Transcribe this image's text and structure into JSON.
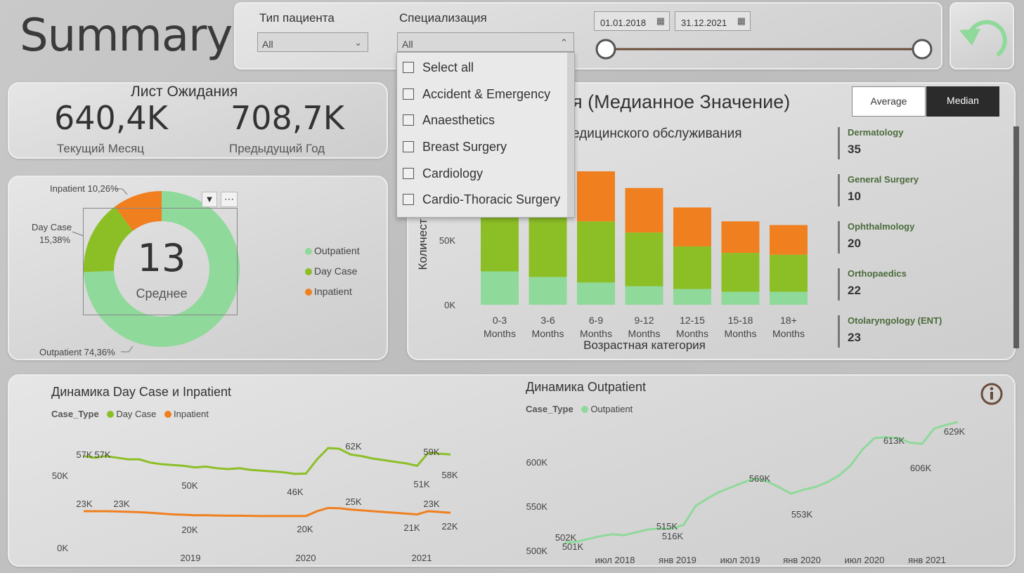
{
  "title": "Summary",
  "filters": {
    "patient_type": {
      "label": "Тип пациента",
      "value": "All"
    },
    "specialization": {
      "label": "Специализация",
      "value": "All"
    },
    "date_from": "01.01.2018",
    "date_to": "31.12.2021"
  },
  "dropdown": {
    "items": [
      "Select all",
      "Accident & Emergency",
      "Anaesthetics",
      "Breast Surgery",
      "Cardiology",
      "Cardio-Thoracic Surgery"
    ]
  },
  "waiting_list": {
    "title": "Лист Ожидания",
    "current_value": "640,4K",
    "current_label": "Текущий Месяц",
    "previous_value": "708,7K",
    "previous_label": "Предыдущий Год"
  },
  "donut": {
    "center_value": "13",
    "center_label": "Среднее",
    "labels": {
      "inpatient": "Inpatient 10,26%",
      "daycase_name": "Day Case",
      "daycase_pct": "15,38%",
      "outpatient": "Outpatient 74,36%"
    },
    "legend": [
      "Outpatient",
      "Day Case",
      "Inpatient"
    ],
    "chart_data": {
      "type": "pie",
      "categories": [
        "Outpatient",
        "Day Case",
        "Inpatient"
      ],
      "values": [
        74.36,
        15.38,
        10.26
      ],
      "colors": [
        "#8fd99a",
        "#8cbf26",
        "#f07f1f"
      ]
    }
  },
  "bar_panel": {
    "title": "я (Медианное Значение)",
    "subtitle": "едицинского обслуживания",
    "ylabel": "Количест",
    "xlabel": "Возрастная категория",
    "toggle": {
      "average": "Average",
      "median": "Median"
    },
    "ticks": [
      "50K",
      "0K"
    ],
    "chart_data": {
      "type": "bar",
      "stacked": true,
      "categories": [
        "0-3 Months",
        "3-6 Months",
        "6-9 Months",
        "9-12 Months",
        "12-15 Months",
        "15-18 Months",
        "18+ Months"
      ],
      "category_lines": [
        [
          "0-3",
          "Months"
        ],
        [
          "3-6",
          "Months"
        ],
        [
          "6-9",
          "Months"
        ],
        [
          "9-12",
          "Months"
        ],
        [
          "12-15",
          "Months"
        ],
        [
          "15-18",
          "Months"
        ],
        [
          "18+",
          "Months"
        ]
      ],
      "series": [
        {
          "values": [
            18000,
            15000,
            12000,
            10000,
            8500,
            7000,
            7000
          ],
          "color": "#8fd99a"
        },
        {
          "values": [
            40000,
            36000,
            33000,
            29000,
            23000,
            21000,
            20000
          ],
          "color": "#8cbf26"
        },
        {
          "values": [
            8000,
            16000,
            27000,
            24000,
            21000,
            17000,
            16000
          ],
          "color": "#f07f1f"
        }
      ],
      "ylim": [
        0,
        72000
      ],
      "xlabel": "Возрастная категория"
    },
    "specialties": [
      {
        "name": "Dermatology",
        "value": "35"
      },
      {
        "name": "General Surgery",
        "value": "10"
      },
      {
        "name": "Ophthalmology",
        "value": "20"
      },
      {
        "name": "Orthopaedics",
        "value": "22"
      },
      {
        "name": "Otolaryngology (ENT)",
        "value": "23"
      }
    ]
  },
  "daycase_chart": {
    "title": "Динамика Day Case и Inpatient",
    "legend_title": "Case_Type",
    "legend": [
      "Day Case",
      "Inpatient"
    ],
    "yticks": [
      "50K",
      "0K"
    ],
    "xticks": [
      "2019",
      "2020",
      "2021"
    ],
    "chart_data": {
      "type": "line",
      "ylim": [
        0,
        75000
      ],
      "series": [
        {
          "name": "Day Case",
          "color": "#8cbf26",
          "values": [
            57000,
            56000,
            57000,
            56000,
            55000,
            55000,
            53000,
            52000,
            51500,
            51000,
            50000,
            50500,
            49500,
            49000,
            49500,
            48500,
            48000,
            47500,
            47000,
            46000,
            46200,
            55000,
            62000,
            61500,
            58000,
            57000,
            55500,
            54500,
            53500,
            52500,
            51000,
            59000,
            58500,
            58000
          ]
        },
        {
          "name": "Inpatient",
          "color": "#f07f1f",
          "values": [
            23000,
            23000,
            23000,
            22800,
            22600,
            22400,
            22000,
            21500,
            21000,
            20800,
            20500,
            20500,
            20300,
            20200,
            20200,
            20100,
            20000,
            20000,
            20000,
            20000,
            20000,
            23000,
            25000,
            24800,
            24000,
            23500,
            23000,
            22500,
            22000,
            21500,
            21000,
            23000,
            22500,
            22000
          ]
        }
      ],
      "labels": {
        "daycase": [
          "57K",
          "57K",
          "50K",
          "46K",
          "62K",
          "51K",
          "59K",
          "58K"
        ],
        "inpatient": [
          "23K",
          "23K",
          "20K",
          "20K",
          "25K",
          "21K",
          "23K",
          "22K"
        ]
      }
    }
  },
  "outpatient_chart": {
    "title": "Динамика Outpatient",
    "legend_title": "Case_Type",
    "legend": [
      "Outpatient"
    ],
    "yticks": [
      "600K",
      "550K",
      "500K"
    ],
    "xticks": [
      "июл 2018",
      "янв 2019",
      "июл 2019",
      "янв 2020",
      "июл 2020",
      "янв 2021"
    ],
    "chart_data": {
      "type": "line",
      "ylim": [
        495000,
        635000
      ],
      "series": [
        {
          "name": "Outpatient",
          "color": "#8fd99a",
          "values": [
            501000,
            502000,
            505000,
            508000,
            510000,
            509000,
            512000,
            515000,
            516000,
            516000,
            520000,
            540000,
            548000,
            555000,
            560000,
            565000,
            569000,
            566000,
            560000,
            553000,
            557000,
            560000,
            565000,
            572000,
            583000,
            600000,
            612000,
            613000,
            612000,
            607000,
            606000,
            622000,
            626000,
            629000
          ]
        }
      ],
      "labels": [
        "502K",
        "501K",
        "515K",
        "516K",
        "569K",
        "553K",
        "613K",
        "606K",
        "629K"
      ]
    }
  },
  "info_icon": "info-icon",
  "reset_icon": "reset-arrow-icon"
}
